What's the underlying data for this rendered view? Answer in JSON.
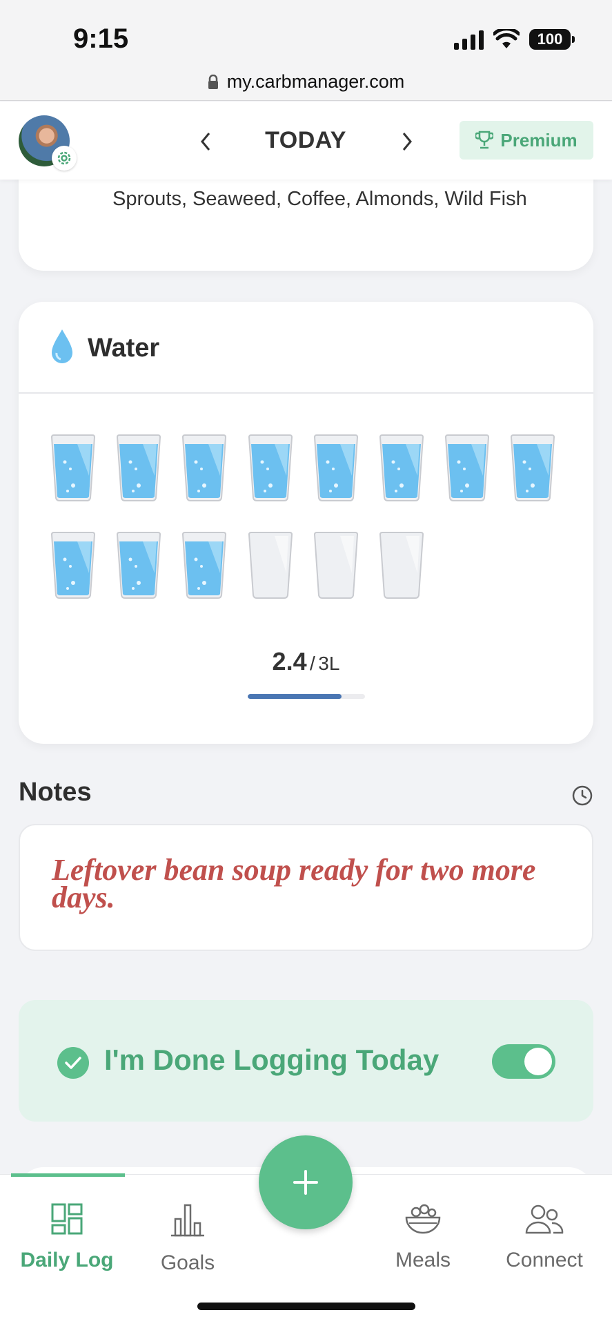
{
  "status_bar": {
    "time": "9:15",
    "battery": "100"
  },
  "browser": {
    "url": "my.carbmanager.com"
  },
  "header": {
    "title": "TODAY",
    "premium_label": "Premium"
  },
  "top_card": {
    "foods_text": "Sprouts, Seaweed, Coffee, Almonds, Wild Fish"
  },
  "water": {
    "title": "Water",
    "consumed": "2.4",
    "separator": "/",
    "goal": "3L",
    "glasses_total": 14,
    "glasses_filled": 11,
    "progress_fraction": 0.8
  },
  "notes": {
    "label": "Notes",
    "text": "Leftover bean soup ready for two more days."
  },
  "done_logging": {
    "label": "I'm Done Logging Today",
    "enabled": true
  },
  "bottom_nav": {
    "tabs": [
      {
        "label": "Daily Log",
        "icon": "daily-log-icon",
        "active": true
      },
      {
        "label": "Goals",
        "icon": "bar-chart-icon",
        "active": false
      },
      {
        "label": "Meals",
        "icon": "salad-bowl-icon",
        "active": false
      },
      {
        "label": "Connect",
        "icon": "people-icon",
        "active": false
      }
    ],
    "fab_icon": "plus-icon"
  },
  "colors": {
    "brand_green": "#5cbf8c",
    "brand_green_text": "#4aa778",
    "water_blue": "#6cc0f0",
    "progress_blue": "#4a76b3",
    "note_red": "#c0504d"
  }
}
